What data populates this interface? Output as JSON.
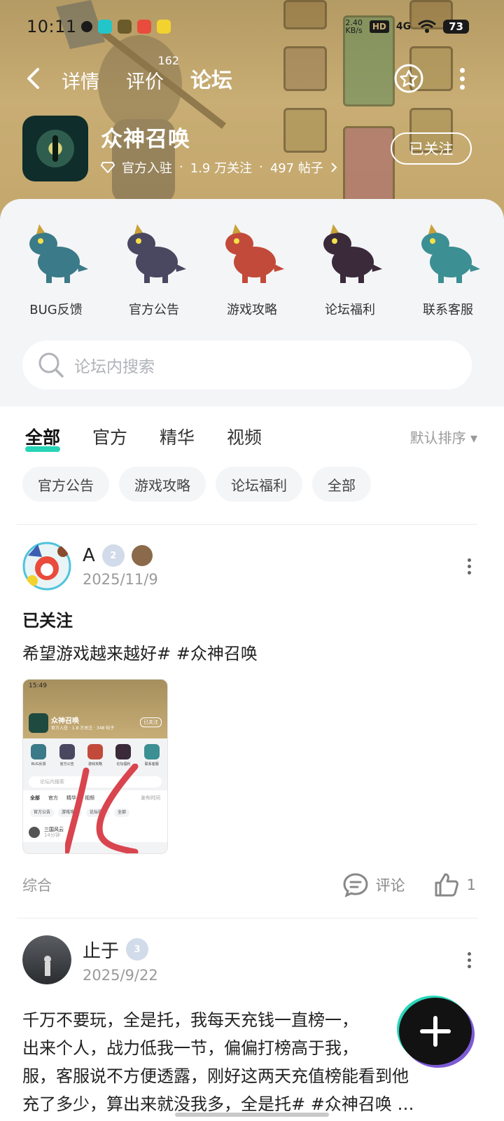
{
  "status_bar": {
    "time": "10:11",
    "speed": "2.40",
    "speed_unit": "KB/s",
    "hd": "HD",
    "network": "4G",
    "battery": "73"
  },
  "top_nav": {
    "tabs": [
      {
        "label": "详情",
        "active": false
      },
      {
        "label": "评价",
        "badge": "162",
        "active": false
      },
      {
        "label": "论坛",
        "active": true
      }
    ]
  },
  "game": {
    "name": "众神召唤",
    "official": "官方入驻",
    "followers": "1.9 万关注",
    "posts": "497 帖子",
    "follow_button": "已关注"
  },
  "quick_links": [
    {
      "label": "BUG反馈",
      "color": "#3b7a88"
    },
    {
      "label": "官方公告",
      "color": "#4a4860"
    },
    {
      "label": "游戏攻略",
      "color": "#c24a3a"
    },
    {
      "label": "论坛福利",
      "color": "#3a2a3a"
    },
    {
      "label": "联系客服",
      "color": "#3c8f92"
    }
  ],
  "search": {
    "placeholder": "论坛内搜索"
  },
  "filter": {
    "tabs": [
      "全部",
      "官方",
      "精华",
      "视频"
    ],
    "sort": "默认排序 ▾"
  },
  "chips": [
    "官方公告",
    "游戏攻略",
    "论坛福利",
    "全部"
  ],
  "posts": [
    {
      "author": "A",
      "level": "2",
      "date": "2025/11/9",
      "title": "已关注",
      "body": "希望游戏越来越好# #众神召唤",
      "category": "综合",
      "comment_label": "评论",
      "likes": "1",
      "thumbnail": {
        "time": "15:49",
        "game_name": "众神召唤",
        "follow": "已关注",
        "meta": "官方入驻 · 1.8 万关注 · 348 帖子",
        "links": [
          "BUG反馈",
          "官方公告",
          "游戏攻略",
          "论坛福利",
          "联系客服"
        ],
        "search": "论坛内搜索",
        "tabs": [
          "全部",
          "官方",
          "精华",
          "视频"
        ],
        "sort": "发布时间",
        "chips": [
          "官方公告",
          "游戏攻略",
          "论坛福利",
          "全部"
        ],
        "user": "三国风云",
        "user_time": "14分钟"
      }
    },
    {
      "author": "止于",
      "level": "3",
      "date": "2025/9/22",
      "body_lines": [
        "千万不要玩，全是托，我每天充钱一直榜一，",
        "出来个人，战力低我一节，偏偏打榜高于我，",
        "服，客服说不方便透露，刚好这两天充值榜能看到他",
        "充了多少，算出来就没我多，全是托# #众神召唤 …"
      ]
    }
  ],
  "colors": {
    "accent": "#27d4b6",
    "header_bg": "#c4a76c",
    "panel_bg": "#f4f5f7"
  }
}
